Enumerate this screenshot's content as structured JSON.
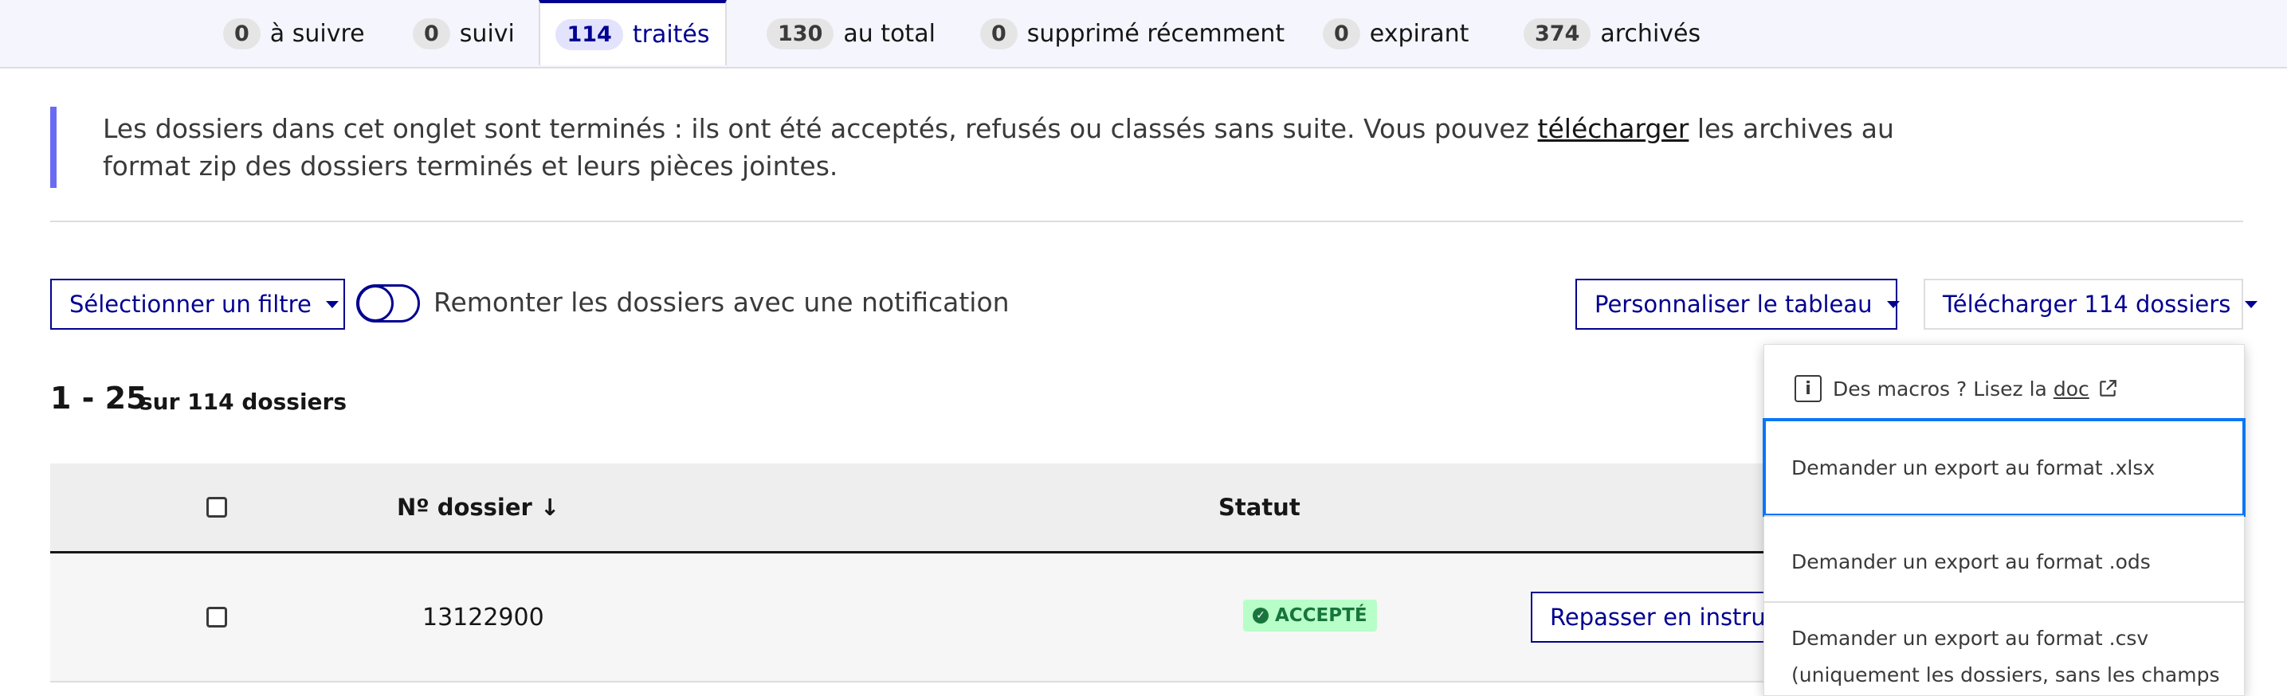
{
  "tabs": [
    {
      "count": "0",
      "label": "à suivre"
    },
    {
      "count": "0",
      "label": "suivi"
    },
    {
      "count": "114",
      "label": "traités"
    },
    {
      "count": "130",
      "label": "au total"
    },
    {
      "count": "0",
      "label": "supprimé récemment"
    },
    {
      "count": "0",
      "label": "expirant"
    },
    {
      "count": "374",
      "label": "archivés"
    }
  ],
  "callout": {
    "text_before": "Les dossiers dans cet onglet sont terminés : ils ont été acceptés, refusés ou classés sans suite. Vous pouvez ",
    "link": "télécharger",
    "text_after": " les archives au format zip des dossiers terminés et leurs pièces jointes."
  },
  "toolbar": {
    "filter_button": "Sélectionner un filtre",
    "toggle_label": "Remonter les dossiers avec une notification",
    "customize_button": "Personnaliser le tableau",
    "download_button": "Télécharger 114 dossiers"
  },
  "pagination": {
    "range": "1 - 25",
    "total": "sur 114 dossiers"
  },
  "table": {
    "headers": {
      "number": "Nº dossier",
      "status": "Statut"
    },
    "rows": [
      {
        "number": "13122900",
        "status": "ACCEPTÉ",
        "action": "Repasser en instruction"
      }
    ]
  },
  "menu": {
    "hint_text": "Des macros ? Lisez la",
    "hint_link": "doc",
    "items": [
      "Demander un export au format .xlsx",
      "Demander un export au format .ods",
      "Demander un export au format .csv",
      "(uniquement les dossiers, sans les champs"
    ]
  },
  "colors": {
    "primary": "#000091",
    "accent_bar": "#6a6af4",
    "success_bg": "#b8fec9",
    "success_fg": "#18753c",
    "focus": "#0a76f6"
  }
}
